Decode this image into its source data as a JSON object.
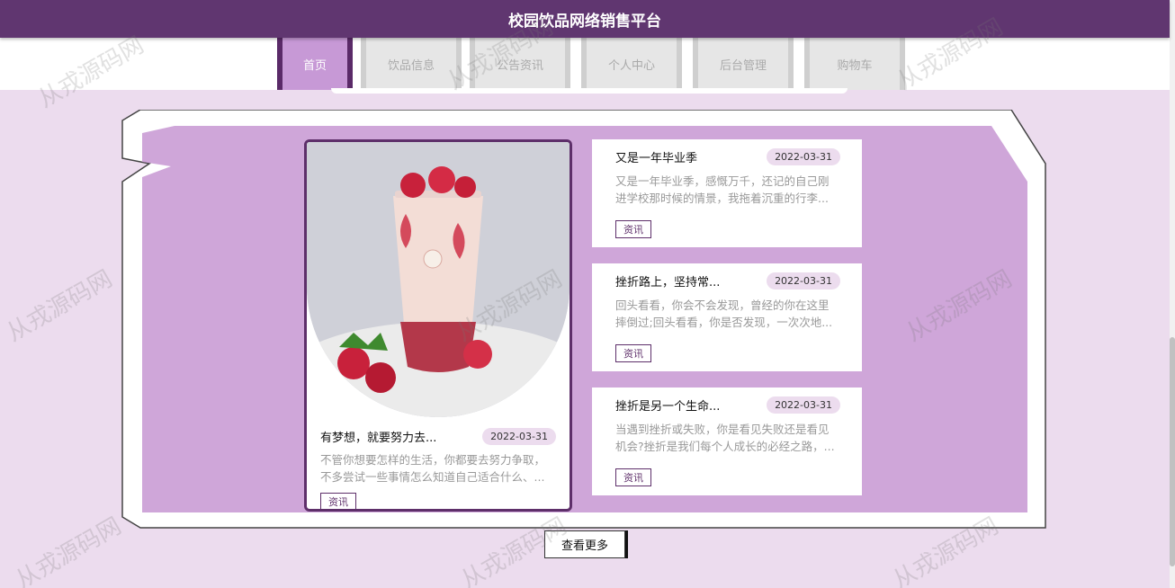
{
  "header": {
    "title": "校园饮品网络销售平台"
  },
  "nav": {
    "items": [
      {
        "label": "首页",
        "active": true
      },
      {
        "label": "饮品信息",
        "active": false
      },
      {
        "label": "公告资讯",
        "active": false
      },
      {
        "label": "个人中心",
        "active": false
      },
      {
        "label": "后台管理",
        "active": false
      },
      {
        "label": "购物车",
        "active": false
      }
    ]
  },
  "featured": {
    "title": "有梦想，就要努力去...",
    "date": "2022-03-31",
    "desc": "不管你想要怎样的生活，你都要去努力争取，不多尝试一些事情怎么知道自己适合什么、...",
    "tag": "资讯"
  },
  "news": [
    {
      "title": "又是一年毕业季",
      "date": "2022-03-31",
      "desc": "又是一年毕业季，感慨万千，还记的自己刚进学校那时候的情景，我拖着沉重的行李...",
      "tag": "资讯"
    },
    {
      "title": "挫折路上，坚持常...",
      "date": "2022-03-31",
      "desc": "回头看看，你会不会发现，曾经的你在这里摔倒过;回头看看，你是否发现，一次次地...",
      "tag": "资讯"
    },
    {
      "title": "挫折是另一个生命...",
      "date": "2022-03-31",
      "desc": "当遇到挫折或失败，你是看见失败还是看见机会?挫折是我们每个人成长的必经之路，...",
      "tag": "资讯"
    }
  ],
  "more_button": "查看更多",
  "watermark": "从戎源码网",
  "colors": {
    "header": "#603670",
    "accent": "#c799d6",
    "background": "#ecdcee",
    "panel": "#cfa6d9"
  }
}
